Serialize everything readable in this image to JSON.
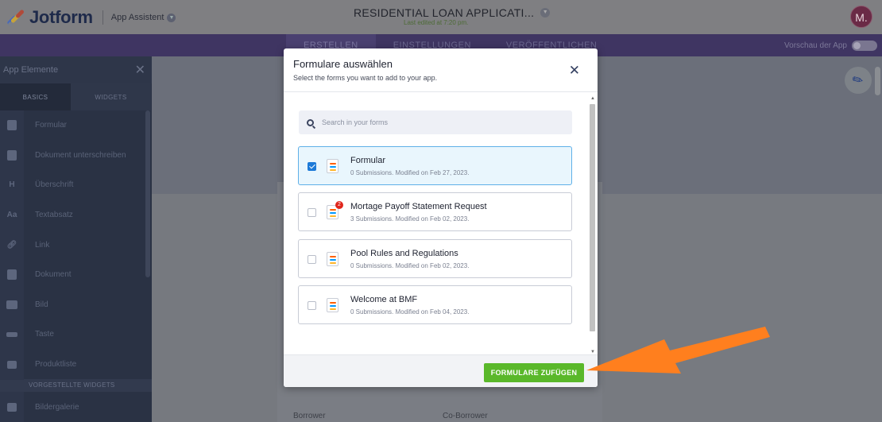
{
  "colors": {
    "accent_green": "#5ab82a",
    "check_blue": "#1d7ad8",
    "selected_border": "#5fb0e8",
    "annotation_orange": "#ff7f1e",
    "nav_purple": "#3f3562"
  },
  "topbar": {
    "logo_text": "Jotform",
    "app_assistant": "App Assistent",
    "form_title": "RESIDENTIAL LOAN APPLICATI...",
    "last_edited": "Last edited at 7:20 pm.",
    "avatar_initial": "M."
  },
  "nav": {
    "tabs": [
      {
        "label": "ERSTELLEN",
        "active": true
      },
      {
        "label": "EINSTELLUNGEN",
        "active": false
      },
      {
        "label": "VERÖFFENTLICHEN",
        "active": false
      }
    ],
    "preview_label": "Vorschau der App"
  },
  "sidebar": {
    "title": "App Elemente",
    "close_icon": "close-icon",
    "tabs": [
      "BASICS",
      "WIDGETS"
    ],
    "items": [
      {
        "label": "Formular",
        "icon": "form-icon"
      },
      {
        "label": "Dokument unterschreiben",
        "icon": "sign-document-icon"
      },
      {
        "label": "Überschrift",
        "icon": "heading-icon",
        "glyph": "H"
      },
      {
        "label": "Textabsatz",
        "icon": "paragraph-icon",
        "glyph": "Aa"
      },
      {
        "label": "Link",
        "icon": "link-icon"
      },
      {
        "label": "Dokument",
        "icon": "document-icon"
      },
      {
        "label": "Bild",
        "icon": "image-icon"
      },
      {
        "label": "Taste",
        "icon": "button-icon"
      },
      {
        "label": "Produktliste",
        "icon": "cart-icon"
      }
    ],
    "section_label": "VORGESTELLTE WIDGETS",
    "section_items": [
      {
        "label": "Bildergalerie",
        "icon": "gallery-icon"
      }
    ]
  },
  "canvas": {
    "borrower_label": "Borrower",
    "co_borrower_label": "Co-Borrower"
  },
  "modal": {
    "title": "Formulare auswählen",
    "subtitle": "Select the forms you want to add to your app.",
    "close_icon": "close-icon",
    "search_placeholder": "Search in your forms",
    "forms": [
      {
        "name": "Formular",
        "meta": "0 Submissions. Modified on Feb 27, 2023.",
        "checked": true,
        "badge": ""
      },
      {
        "name": "Mortage Payoff Statement Request",
        "meta": "3 Submissions. Modified on Feb 02, 2023.",
        "checked": false,
        "badge": "2"
      },
      {
        "name": "Pool Rules and Regulations",
        "meta": "0 Submissions. Modified on Feb 02, 2023.",
        "checked": false,
        "badge": ""
      },
      {
        "name": "Welcome at BMF",
        "meta": "0 Submissions. Modified on Feb 04, 2023.",
        "checked": false,
        "badge": ""
      }
    ],
    "add_button": "FORMULARE ZUFÜGEN"
  }
}
